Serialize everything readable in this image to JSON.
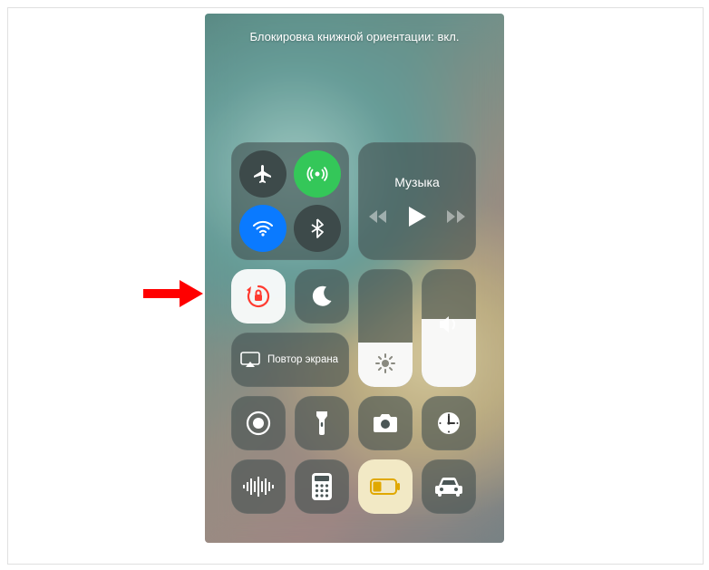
{
  "status_text": "Блокировка книжной ориентации: вкл.",
  "media": {
    "title": "Музыка"
  },
  "screen_mirroring": {
    "label": "Повтор экрана"
  },
  "connectivity": {
    "airplane": {
      "active": false,
      "bg": "#3d4a4a",
      "fg": "#ffffff"
    },
    "cellular": {
      "active": true,
      "bg": "#34c759",
      "fg": "#ffffff"
    },
    "wifi": {
      "active": true,
      "bg": "#0a7aff",
      "fg": "#ffffff"
    },
    "bluetooth": {
      "active": false,
      "bg": "#3d4a4a",
      "fg": "#ffffff"
    }
  },
  "brightness": {
    "level_pct": 38
  },
  "volume": {
    "level_pct": 58
  },
  "toggles": {
    "orientation_lock": {
      "active": true
    },
    "do_not_disturb": {
      "active": false
    },
    "low_power": {
      "active": true
    }
  }
}
